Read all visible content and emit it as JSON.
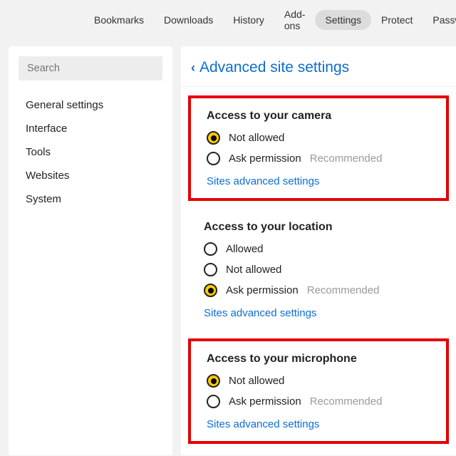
{
  "topnav": {
    "items": [
      {
        "label": "Bookmarks",
        "active": false
      },
      {
        "label": "Downloads",
        "active": false
      },
      {
        "label": "History",
        "active": false
      },
      {
        "label": "Add-ons",
        "active": false
      },
      {
        "label": "Settings",
        "active": true
      },
      {
        "label": "Protect",
        "active": false
      },
      {
        "label": "Passwords",
        "active": false
      }
    ]
  },
  "sidebar": {
    "search_placeholder": "Search",
    "items": [
      {
        "label": "General settings"
      },
      {
        "label": "Interface"
      },
      {
        "label": "Tools"
      },
      {
        "label": "Websites"
      },
      {
        "label": "System"
      }
    ]
  },
  "main": {
    "back": "‹",
    "title": "Advanced site settings",
    "sections": [
      {
        "heading": "Access to your camera",
        "boxed": true,
        "options": [
          {
            "label": "Not allowed",
            "selected": true,
            "recommended": false
          },
          {
            "label": "Ask permission",
            "selected": false,
            "recommended": true
          }
        ],
        "link": "Sites advanced settings"
      },
      {
        "heading": "Access to your location",
        "boxed": false,
        "options": [
          {
            "label": "Allowed",
            "selected": false,
            "recommended": false
          },
          {
            "label": "Not allowed",
            "selected": false,
            "recommended": false
          },
          {
            "label": "Ask permission",
            "selected": true,
            "recommended": true
          }
        ],
        "link": "Sites advanced settings"
      },
      {
        "heading": "Access to your microphone",
        "boxed": true,
        "options": [
          {
            "label": "Not allowed",
            "selected": true,
            "recommended": false
          },
          {
            "label": "Ask permission",
            "selected": false,
            "recommended": true
          }
        ],
        "link": "Sites advanced settings"
      }
    ],
    "recommended_text": "Recommended"
  }
}
